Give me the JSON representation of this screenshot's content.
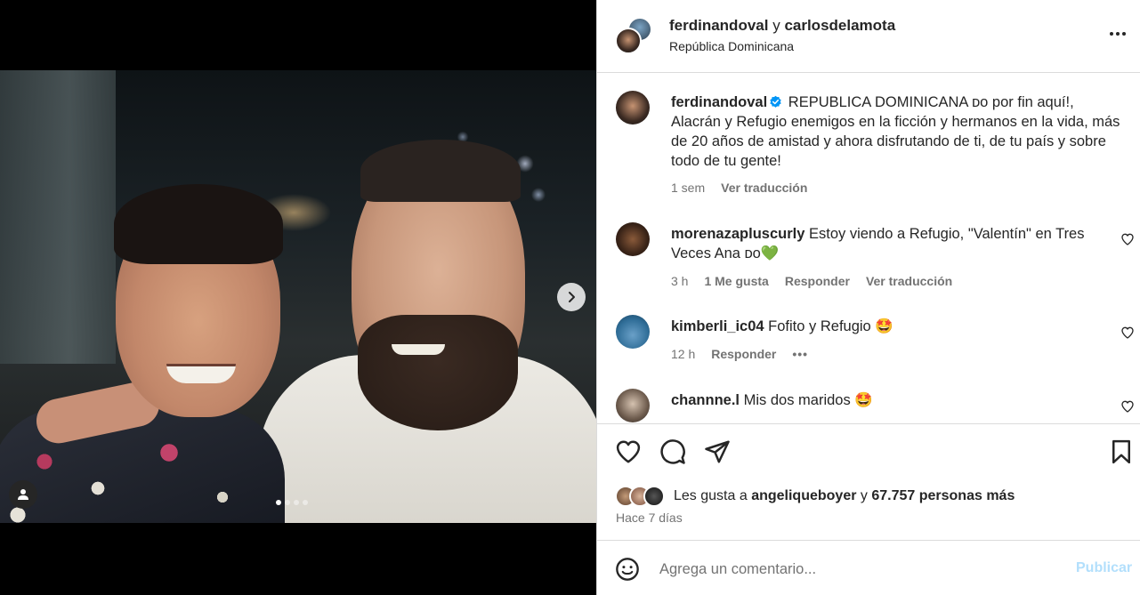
{
  "post": {
    "authors": {
      "primary": "ferdinandoval",
      "conjunction": "y",
      "secondary": "carlosdelamota"
    },
    "location": "República Dominicana",
    "carousel": {
      "current_index": 1,
      "total": 4
    }
  },
  "caption": {
    "username": "ferdinandoval",
    "text": "REPUBLICA DOMINICANA ᴅᴏ por fin aquí!, Alacrán y Refugio enemigos en la ficción y hermanos en la vida, más de 20 años de amistad y ahora disfrutando de ti, de tu país y sobre todo de tu gente!",
    "time": "1 sem",
    "translate": "Ver traducción"
  },
  "comments": [
    {
      "username": "morenazapluscurly",
      "text": "Estoy viendo a Refugio, \"Valentín\" en Tres Veces Ana ᴅᴏ💚",
      "time": "3 h",
      "likes": "1 Me gusta",
      "reply": "Responder",
      "translate": "Ver traducción"
    },
    {
      "username": "kimberli_ic04",
      "text": "Fofito y Refugio 🤩",
      "time": "12 h",
      "reply": "Responder",
      "more": "•••"
    },
    {
      "username": "channne.l",
      "text": "Mis dos maridos 🤩"
    }
  ],
  "likes": {
    "prefix": "Les gusta a",
    "user": "angeliqueboyer",
    "conjunction": "y",
    "others": "67.757 personas más"
  },
  "date": "Hace 7 días",
  "add_comment": {
    "placeholder": "Agrega un comentario...",
    "publish_label": "Publicar"
  },
  "colors": {
    "text": "#262626",
    "secondary": "#737373",
    "border": "#dbdbdb",
    "verified": "#0095f6",
    "publish_disabled": "#b2dffc"
  }
}
